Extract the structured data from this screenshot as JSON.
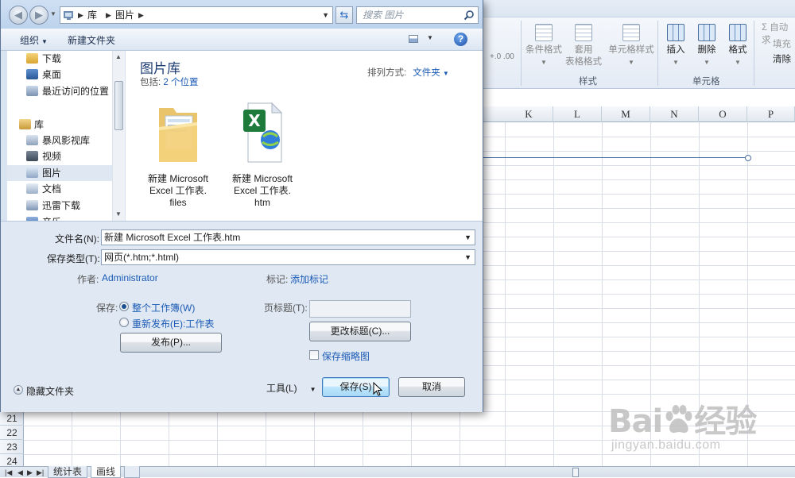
{
  "excel": {
    "ribbon": {
      "cond_format": "条件格式",
      "table_format_1": "套用",
      "table_format_2": "表格格式",
      "cell_style": "单元格样式",
      "styles_group": "样式",
      "insert": "插入",
      "delete": "删除",
      "format": "格式",
      "cells_group": "单元格",
      "autosum": "Σ 自动求",
      "fill": "填充",
      "clear": "清除",
      "number_fmt": "+.0 .00"
    },
    "columns": [
      "K",
      "L",
      "M",
      "N",
      "O",
      "P"
    ],
    "rows": [
      "21",
      "22",
      "23",
      "24"
    ],
    "sheet_tabs": [
      "统计表",
      "画线"
    ],
    "active_tab": "画线"
  },
  "watermark": {
    "brand": "Bai",
    "brand_cn": "经验",
    "url": "jingyan.baidu.com"
  },
  "dialog": {
    "address": {
      "crumbs": [
        "库",
        "图片"
      ]
    },
    "search_placeholder": "搜索 图片",
    "toolbar": {
      "organize": "组织",
      "new_folder": "新建文件夹"
    },
    "nav": [
      {
        "label": "下载",
        "icon": "download-folder-icon",
        "type": "item"
      },
      {
        "label": "桌面",
        "icon": "desktop-icon",
        "type": "item"
      },
      {
        "label": "最近访问的位置",
        "icon": "recent-places-icon",
        "type": "item"
      },
      {
        "label": "库",
        "icon": "library-icon",
        "type": "header"
      },
      {
        "label": "暴风影视库",
        "icon": "video-library-icon",
        "type": "item"
      },
      {
        "label": "视频",
        "icon": "video-icon",
        "type": "item"
      },
      {
        "label": "图片",
        "icon": "pictures-icon",
        "type": "item",
        "selected": true
      },
      {
        "label": "文档",
        "icon": "documents-icon",
        "type": "item"
      },
      {
        "label": "迅雷下载",
        "icon": "thunder-download-icon",
        "type": "item"
      },
      {
        "label": "音乐",
        "icon": "music-icon",
        "type": "item"
      }
    ],
    "library": {
      "title": "图片库",
      "includes_label": "包括:",
      "includes_link": "2 个位置",
      "arrange_label": "排列方式:",
      "arrange_value": "文件夹"
    },
    "files": [
      {
        "line1": "新建 Microsoft",
        "line2": "Excel 工作表.",
        "line3": "files",
        "icon": "folder-icon"
      },
      {
        "line1": "新建 Microsoft",
        "line2": "Excel 工作表.",
        "line3": "htm",
        "icon": "excel-html-file-icon"
      }
    ],
    "form": {
      "filename_label": "文件名(N):",
      "filename_value": "新建 Microsoft Excel 工作表.htm",
      "type_label": "保存类型(T):",
      "type_value": "网页(*.htm;*.html)",
      "author_label": "作者:",
      "author_value": "Administrator",
      "tags_label": "标记:",
      "tags_value": "添加标记",
      "save_label": "保存:",
      "radio_whole": "整个工作簿(W)",
      "radio_republish": "重新发布(E):工作表",
      "publish_btn": "发布(P)...",
      "page_title_label": "页标题(T):",
      "change_title_btn": "更改标题(C)...",
      "save_thumbnail": "保存缩略图",
      "hide_folders": "隐藏文件夹",
      "tools": "工具(L)",
      "save_btn": "保存(S)",
      "cancel_btn": "取消"
    }
  }
}
